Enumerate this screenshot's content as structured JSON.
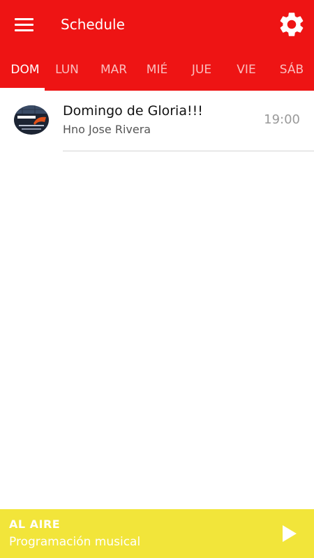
{
  "header": {
    "title": "Schedule",
    "menu_icon": "hamburger-menu-icon",
    "settings_icon": "gear-icon",
    "color": "#ee1414"
  },
  "tabs": [
    {
      "label": "DOM",
      "active": true
    },
    {
      "label": "LUN",
      "active": false
    },
    {
      "label": "MAR",
      "active": false
    },
    {
      "label": "MIÉ",
      "active": false
    },
    {
      "label": "JUE",
      "active": false
    },
    {
      "label": "VIE",
      "active": false
    },
    {
      "label": "SÁB",
      "active": false
    }
  ],
  "schedule": [
    {
      "title": "Domingo de Gloria!!!",
      "host": "Hno Jose Rivera",
      "time": "19:00",
      "avatar_icon": "show-logo-image"
    }
  ],
  "player": {
    "status": "AL AIRE",
    "program": "Programación musical",
    "play_icon": "play-icon",
    "color": "#f2e53a"
  }
}
